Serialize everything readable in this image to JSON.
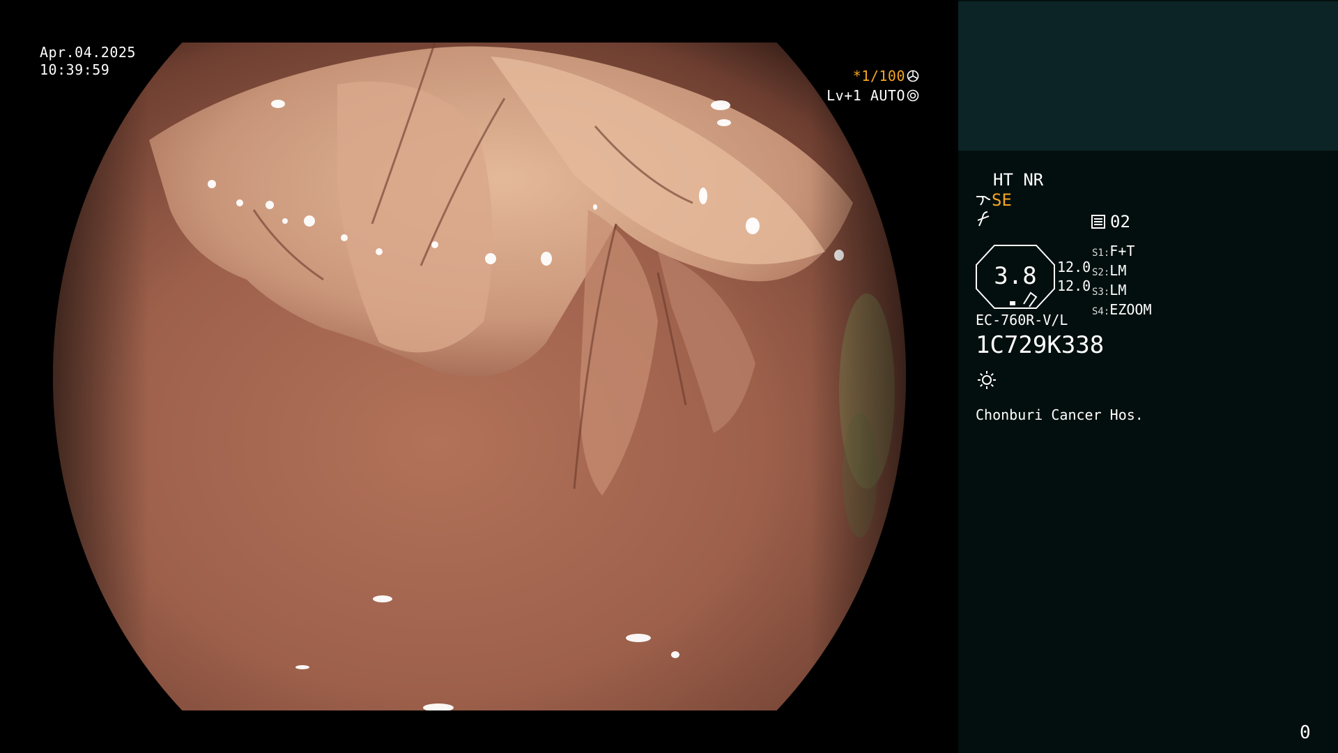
{
  "overlay": {
    "date": "Apr.04.2025",
    "time": "10:39:59",
    "shutter_prefix": "*",
    "shutter": "1/100",
    "level": "Lv+1 AUTO"
  },
  "panel": {
    "enhancement": "HT NR",
    "structure_mode": "SE",
    "memory_slot": "02",
    "gauge_value": "3.8",
    "gauge_side_top": "12.0",
    "gauge_side_bottom": "12.0",
    "switches": [
      {
        "key": "S1:",
        "value": "F+T"
      },
      {
        "key": "S2:",
        "value": "LM"
      },
      {
        "key": "S3:",
        "value": "LM"
      },
      {
        "key": "S4:",
        "value": "EZOOM"
      }
    ],
    "scope_model": "EC-760R-V/L",
    "scope_serial": "1C729K338",
    "hospital": "Chonburi Cancer Hos.",
    "counter": "0"
  },
  "colors": {
    "accent_orange": "#f5a623",
    "panel_top": "#0c2426",
    "panel_bg": "#030f0e"
  }
}
